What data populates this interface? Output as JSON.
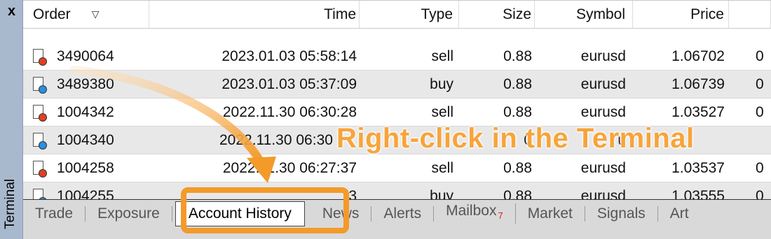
{
  "sidebar": {
    "close_label": "x",
    "label": "Terminal"
  },
  "table": {
    "columns": [
      "Order",
      "Time",
      "Type",
      "Size",
      "Symbol",
      "Price"
    ],
    "rows": [
      {
        "order": "3490064",
        "time": "2023.01.03 05:58:14",
        "type": "sell",
        "size": "0.88",
        "symbol": "eurusd",
        "price": "1.06702",
        "extra": "0"
      },
      {
        "order": "3489380",
        "time": "2023.01.03 05:37:09",
        "type": "buy",
        "size": "0.88",
        "symbol": "eurusd",
        "price": "1.06739",
        "extra": "0"
      },
      {
        "order": "1004342",
        "time": "2022.11.30 06:30:28",
        "type": "sell",
        "size": "0.88",
        "symbol": "eurusd",
        "price": "1.03527",
        "extra": "0"
      },
      {
        "order": "1004340",
        "time": "2022.11.30 06:30",
        "type": "",
        "size": "0",
        "symbol": "u",
        "price": "",
        "extra": ""
      },
      {
        "order": "1004258",
        "time": "2022.11.30 06:27:37",
        "type": "sell",
        "size": "0.88",
        "symbol": "eurusd",
        "price": "1.03537",
        "extra": "0"
      },
      {
        "order": "1004255",
        "time": "3",
        "type": "buy",
        "size": "0.88",
        "symbol": "eurusd",
        "price": "1.03555",
        "extra": "0"
      }
    ]
  },
  "tabs": [
    {
      "label": "Trade"
    },
    {
      "label": "Exposure"
    },
    {
      "label": "Account History",
      "active": true
    },
    {
      "label": "News"
    },
    {
      "label": "Alerts"
    },
    {
      "label": "Mailbox",
      "badge": "7"
    },
    {
      "label": "Market"
    },
    {
      "label": "Signals"
    },
    {
      "label": "Art"
    }
  ],
  "annotation": {
    "text": "Right-click in the Terminal"
  },
  "colors": {
    "accent": "#f39a2a",
    "sell_dot": "#e04020",
    "buy_dot": "#2a8fe0",
    "alt_row": "#e8e8e8"
  }
}
